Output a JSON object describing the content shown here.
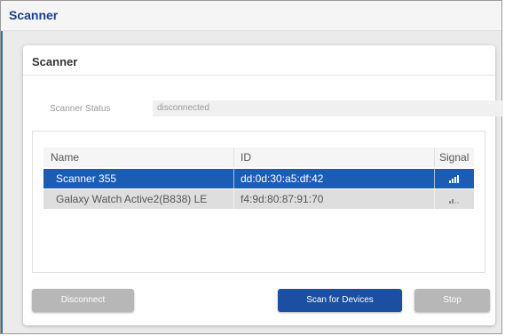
{
  "app": {
    "title": "Scanner"
  },
  "card": {
    "title": "Scanner"
  },
  "status": {
    "label": "Scanner Status",
    "value": "disconnected"
  },
  "table": {
    "columns": [
      "Name",
      "ID",
      "Signal"
    ],
    "rows": [
      {
        "name": "Scanner 355",
        "id": "dd:0d:30:a5:df:42",
        "signal_bars": 4,
        "selected": true
      },
      {
        "name": "Galaxy Watch Active2(B838) LE",
        "id": "f4:9d:80:87:91:70",
        "signal_bars": 2,
        "selected": false
      }
    ]
  },
  "buttons": {
    "disconnect": "Disconnect",
    "scan": "Scan for Devices",
    "stop": "Stop"
  },
  "colors": {
    "title": "#1a3e86",
    "selected_row": "#1a5db3",
    "primary_button": "#1a4fa1",
    "disabled_button": "#b7b7b7"
  }
}
